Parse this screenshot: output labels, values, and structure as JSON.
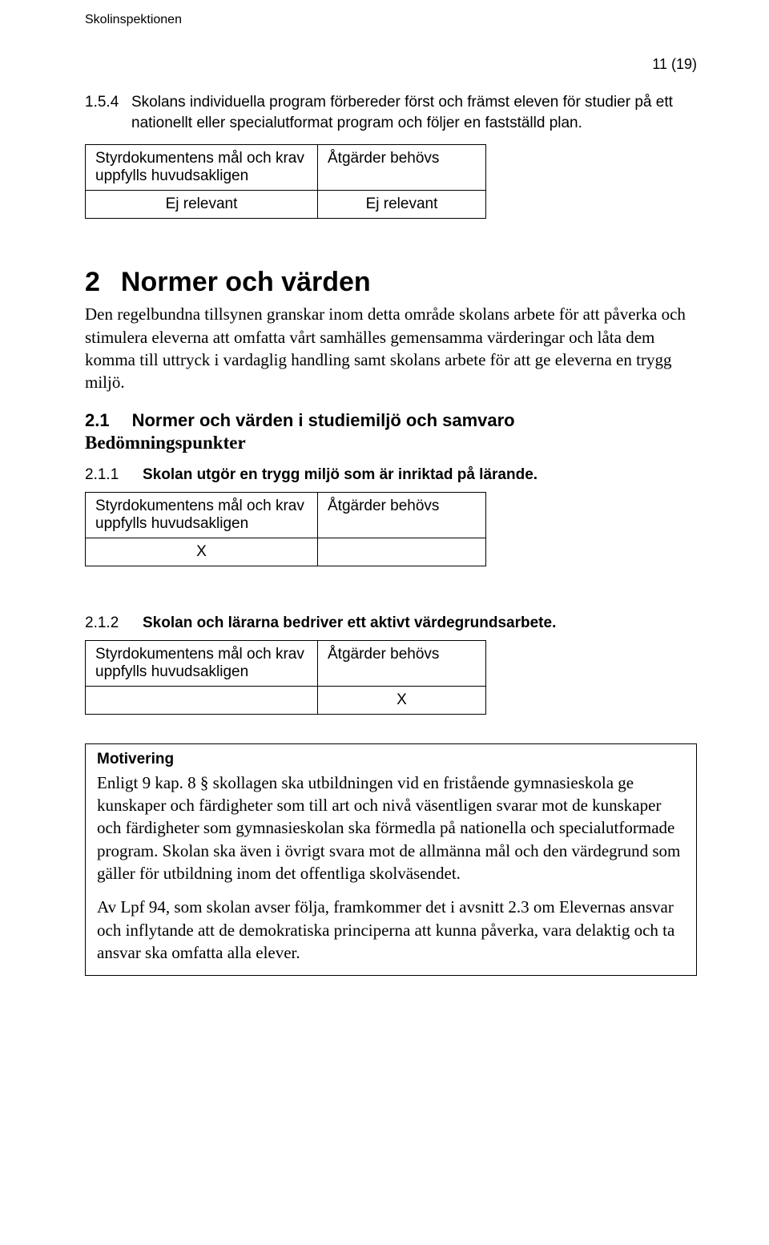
{
  "org": "Skolinspektionen",
  "page_number": "11 (19)",
  "item_1_5_4": {
    "num": "1.5.4",
    "text": "Skolans individuella program förbereder först och främst eleven för studier på ett nationellt eller specialutformat program och följer en fastställd plan."
  },
  "table1": {
    "cell_a": "Styrdokumentens mål och krav uppfylls huvudsakligen",
    "cell_b": "Åtgärder behövs",
    "val_a": "Ej relevant",
    "val_b": "Ej relevant"
  },
  "section2": {
    "num": "2",
    "title": "Normer och värden",
    "intro": "Den regelbundna tillsynen granskar inom detta område skolans arbete för att påverka och stimulera eleverna att omfatta vårt samhälles gemensamma värderingar och låta dem komma till uttryck i vardaglig handling samt skolans arbete för att ge eleverna en trygg miljö."
  },
  "section2_1": {
    "num": "2.1",
    "title": "Normer och värden i studiemiljö och samvaro",
    "bed": "Bedömningspunkter"
  },
  "item_2_1_1": {
    "num": "2.1.1",
    "text": "Skolan utgör en trygg miljö som är inriktad på lärande."
  },
  "table2_1_1": {
    "cell_a": "Styrdokumentens mål och krav uppfylls huvudsakligen",
    "cell_b": "Åtgärder behövs",
    "val_a": "X",
    "val_b": ""
  },
  "item_2_1_2": {
    "num": "2.1.2",
    "text": "Skolan och lärarna bedriver ett aktivt värdegrundsarbete."
  },
  "table2_1_2": {
    "cell_a": "Styrdokumentens mål och krav uppfylls huvudsakligen",
    "cell_b": "Åtgärder behövs",
    "val_a": "",
    "val_b": "X"
  },
  "motivering": {
    "title": "Motivering",
    "p1": "Enligt 9 kap. 8 § skollagen ska utbildningen vid en fristående gymnasieskola ge kunskaper och färdigheter som till art och nivå väsentligen svarar mot de kun­skaper och färdigheter som gymnasieskolan ska förmedla på nationella och spe­cialutformade program. Skolan ska även i övrigt svara mot de allmänna mål och den värdegrund som gäller för utbildning inom det offentliga skolväsendet.",
    "p2": "Av Lpf 94, som skolan avser följa, framkommer det i avsnitt 2.3 om Elevernas ansvar och inflytande att de demokratiska principerna att kunna påverka, vara delaktig och ta ansvar ska omfatta alla elever."
  }
}
